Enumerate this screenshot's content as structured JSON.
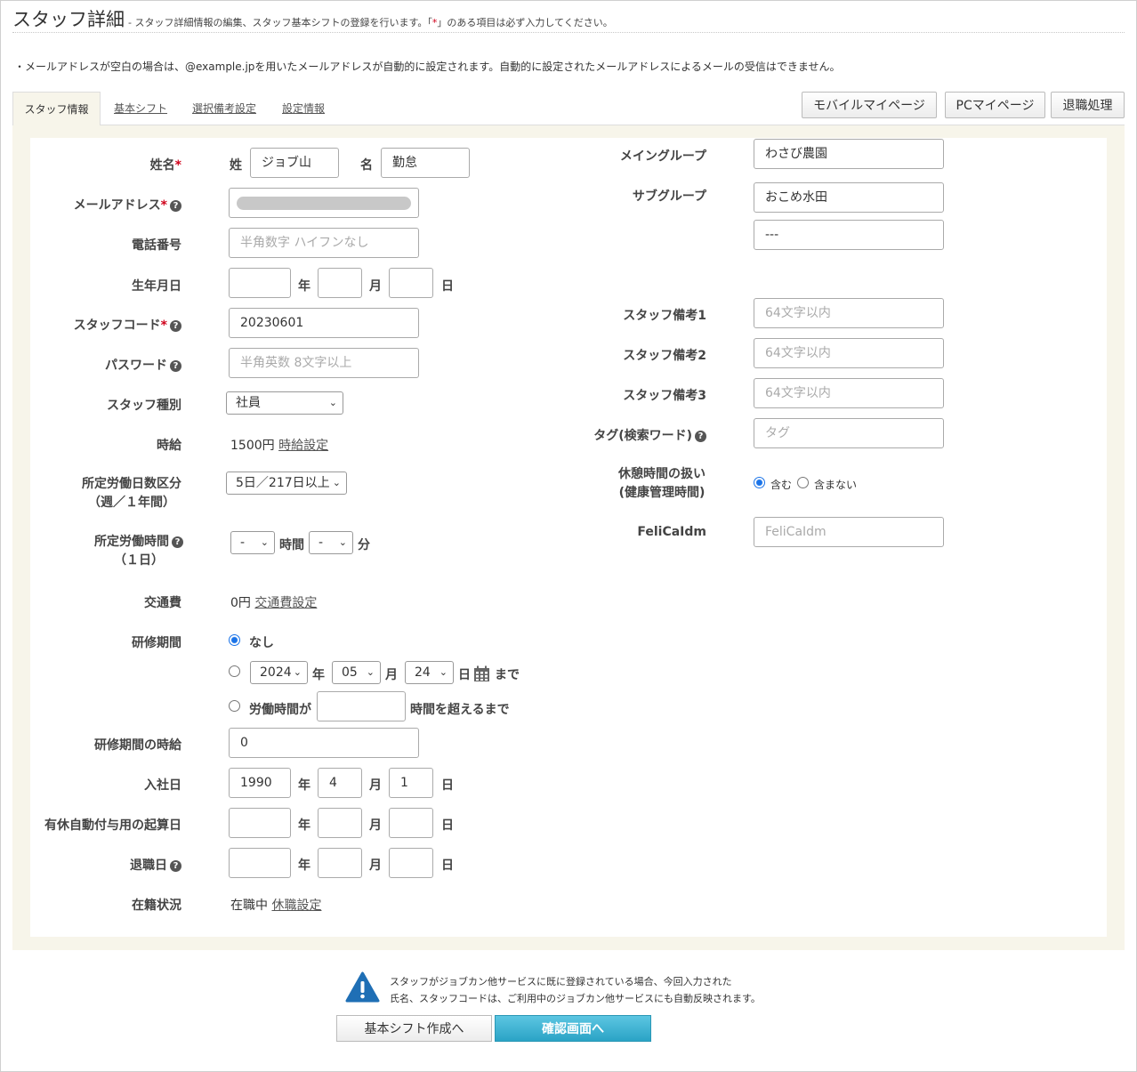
{
  "header": {
    "title": "スタッフ詳細",
    "desc_pre": "- スタッフ詳細情報の編集、スタッフ基本シフトの登録を行います。「",
    "desc_req": "*",
    "desc_post": "」のある項目は必ず入力してください。"
  },
  "notice": "・メールアドレスが空白の場合は、@example.jpを用いたメールアドレスが自動的に設定されます。自動的に設定されたメールアドレスによるメールの受信はできません。",
  "tabs": [
    "スタッフ情報",
    "基本シフト",
    "選択備考設定",
    "設定情報"
  ],
  "top_buttons": [
    "モバイルマイページ",
    "PCマイページ",
    "退職処理"
  ],
  "required_mark": "*",
  "left": {
    "name": {
      "label": "姓名",
      "last_label": "姓",
      "last_value": "ジョブ山",
      "first_label": "名",
      "first_value": "勤怠"
    },
    "email": {
      "label": "メールアドレス"
    },
    "phone": {
      "label": "電話番号",
      "placeholder": "半角数字 ハイフンなし"
    },
    "birth": {
      "label": "生年月日",
      "year_unit": "年",
      "month_unit": "月",
      "day_unit": "日"
    },
    "staff_code": {
      "label": "スタッフコード",
      "value": "20230601"
    },
    "password": {
      "label": "パスワード",
      "placeholder": "半角英数 8文字以上"
    },
    "staff_type": {
      "label": "スタッフ種別",
      "value": "社員"
    },
    "wage": {
      "label": "時給",
      "value": "1500円",
      "link": "時給設定"
    },
    "workdays": {
      "label_line1": "所定労働日数区分",
      "label_line2": "（週／１年間）",
      "value": "5日／217日以上"
    },
    "workhours": {
      "label_line1": "所定労働時間",
      "label_line2": "（１日）",
      "hour_value": "-",
      "hour_unit": "時間",
      "min_value": "-",
      "min_unit": "分"
    },
    "transport": {
      "label": "交通費",
      "value": "0円",
      "link": "交通費設定"
    },
    "training": {
      "label": "研修期間",
      "opt_none": "なし",
      "year": "2024",
      "year_unit": "年",
      "month": "05",
      "month_unit": "月",
      "day": "24",
      "day_unit": "日",
      "until": "まで",
      "hours_pre": "労働時間が",
      "hours_post": "時間を超えるまで"
    },
    "training_wage": {
      "label": "研修期間の時給",
      "value": "0"
    },
    "join": {
      "label": "入社日",
      "year": "1990",
      "month": "4",
      "day": "1",
      "year_unit": "年",
      "month_unit": "月",
      "day_unit": "日"
    },
    "leave_base": {
      "label": "有休自動付与用の起算日",
      "year_unit": "年",
      "month_unit": "月",
      "day_unit": "日"
    },
    "retire": {
      "label": "退職日",
      "year_unit": "年",
      "month_unit": "月",
      "day_unit": "日"
    },
    "status": {
      "label": "在籍状況",
      "value": "在職中",
      "link": "休職設定"
    }
  },
  "right": {
    "main_group": {
      "label": "メイングループ",
      "value": "わさび農園"
    },
    "sub_group": {
      "label": "サブグループ",
      "value1": "おこめ水田",
      "value2": "---"
    },
    "memo1": {
      "label": "スタッフ備考1",
      "placeholder": "64文字以内"
    },
    "memo2": {
      "label": "スタッフ備考2",
      "placeholder": "64文字以内"
    },
    "memo3": {
      "label": "スタッフ備考3",
      "placeholder": "64文字以内"
    },
    "tag": {
      "label": "タグ(検索ワード)",
      "placeholder": "タグ"
    },
    "break": {
      "label_line1": "休憩時間の扱い",
      "label_line2": "(健康管理時間)",
      "opt_include": "含む",
      "opt_exclude": "含まない"
    },
    "felica": {
      "label": "FeliCaIdm",
      "placeholder": "FeliCaIdm"
    }
  },
  "footer": {
    "warn_line1": "スタッフがジョブカン他サービスに既に登録されている場合、今回入力された",
    "warn_line2": "氏名、スタッフコードは、ご利用中のジョブカン他サービスにも自動反映されます。",
    "btn_shift": "基本シフト作成へ",
    "btn_confirm": "確認画面へ"
  },
  "colors": {
    "panel_bg": "#f7f5ea",
    "required": "#d0021b",
    "primary_button": "#2aa3c6",
    "warn_icon": "#1f6fb5",
    "radio_checked": "#1a73e8"
  },
  "icons": {
    "help": "question-circle-icon",
    "calendar": "calendar-icon",
    "warning": "warning-triangle-icon",
    "select": "chevron-down-icon"
  }
}
